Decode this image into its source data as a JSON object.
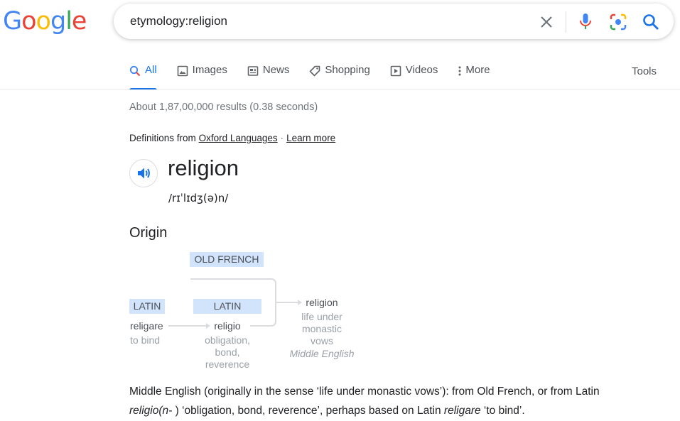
{
  "logo": {
    "letters": [
      {
        "ch": "G",
        "color": "#4285F4"
      },
      {
        "ch": "o",
        "color": "#EA4335"
      },
      {
        "ch": "o",
        "color": "#FBBC05"
      },
      {
        "ch": "g",
        "color": "#4285F4"
      },
      {
        "ch": "l",
        "color": "#34A853"
      },
      {
        "ch": "e",
        "color": "#EA4335"
      }
    ]
  },
  "search": {
    "query": "etymology:religion"
  },
  "icons": {
    "clear": "close-icon",
    "mic": "microphone-icon",
    "lens": "camera-lens-icon",
    "search": "search-icon",
    "speaker": "speaker-icon"
  },
  "tabs": [
    {
      "label": "All",
      "icon": "search-icon",
      "active": true
    },
    {
      "label": "Images",
      "icon": "image-icon"
    },
    {
      "label": "News",
      "icon": "news-icon"
    },
    {
      "label": "Shopping",
      "icon": "tag-icon"
    },
    {
      "label": "Videos",
      "icon": "play-icon"
    },
    {
      "label": "More",
      "icon": "more-vert-icon"
    }
  ],
  "tools_label": "Tools",
  "result_stats": "About 1,87,00,000 results (0.38 seconds)",
  "definitions": {
    "prefix": "Definitions from",
    "source": "Oxford Languages",
    "separator": "·",
    "learn_more": "Learn more"
  },
  "word": "religion",
  "phonetic": "/rɪˈlɪdʒ(ə)n/",
  "origin_heading": "Origin",
  "etymology": {
    "old_french": {
      "lang": "OLD FRENCH"
    },
    "latin1": {
      "lang": "LATIN",
      "word": "religare",
      "meaning": "to bind"
    },
    "latin2": {
      "lang": "LATIN",
      "word": "religio",
      "meaning": [
        "obligation,",
        "bond,",
        "reverence"
      ]
    },
    "result": {
      "word": "religion",
      "meaning": [
        "life under",
        "monastic",
        "vows"
      ],
      "lang": "Middle English"
    }
  },
  "summary": {
    "p1": "Middle English (originally in the sense ‘life under monastic vows’): from Old French, or from Latin",
    "i1": "religio(n-",
    "p2": " ) ‘obligation, bond, reverence’, perhaps based on Latin ",
    "i2": "religare",
    "p3": " ‘to bind’."
  },
  "colors": {
    "link_blue": "#1a73e8",
    "chip_bg": "#d2e3fc",
    "text_grey": "#70757a"
  }
}
